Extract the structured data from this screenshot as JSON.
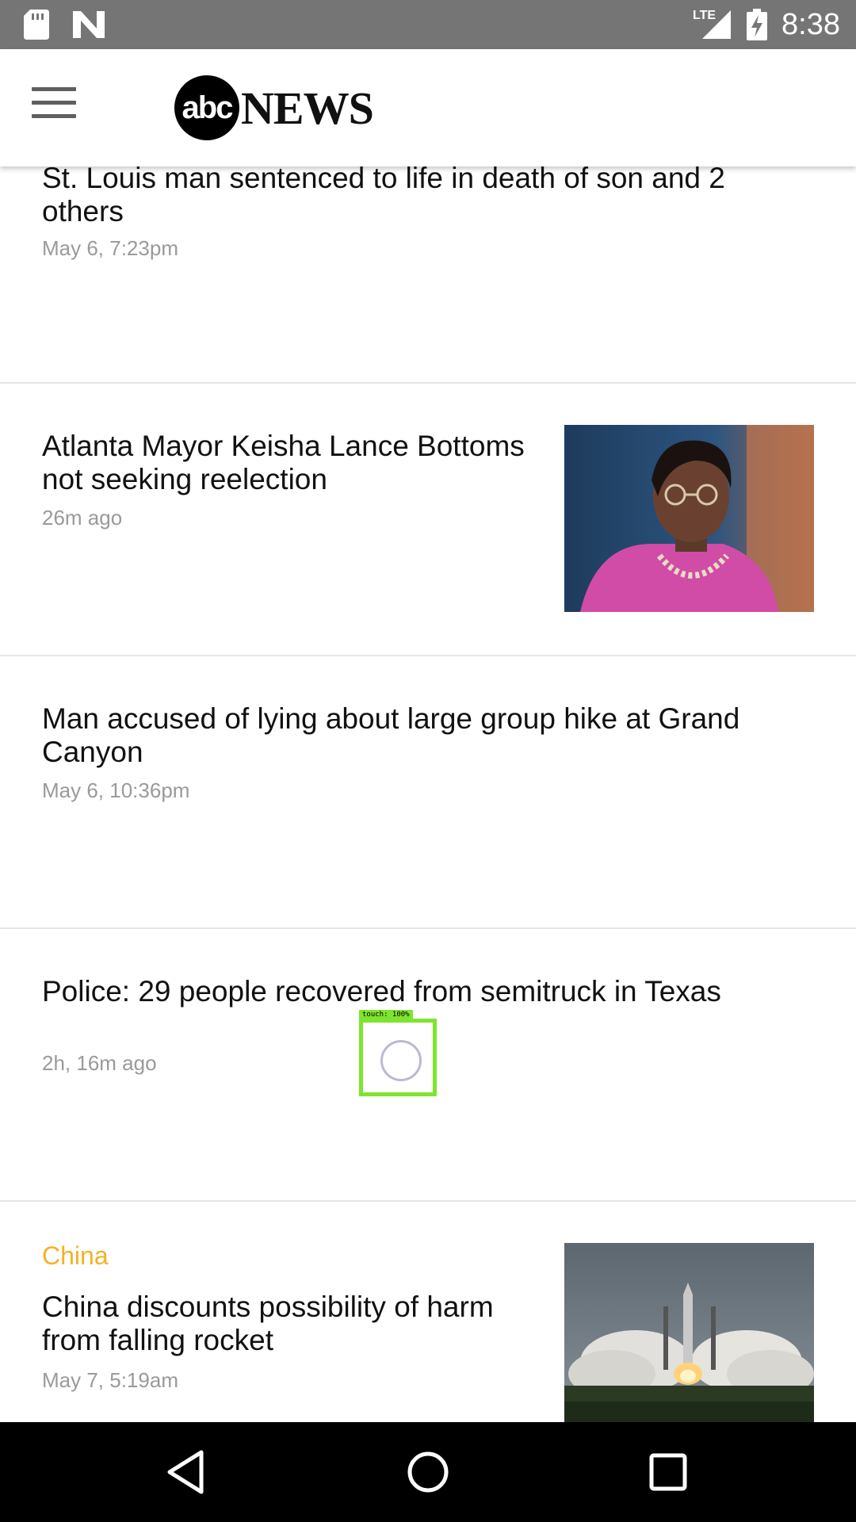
{
  "status_bar": {
    "time": "8:38",
    "network": "LTE",
    "icons": [
      "sd-card-icon",
      "n-notification-icon",
      "lte-signal-icon",
      "battery-charging-icon"
    ]
  },
  "header": {
    "logo_abc": "abc",
    "logo_news": "NEWS",
    "menu_icon": "hamburger-menu-icon"
  },
  "articles": [
    {
      "title": "St. Louis man sentenced to life in death of son and 2 others",
      "time": "May 6, 7:23pm"
    },
    {
      "title": "Atlanta Mayor Keisha Lance Bottoms not seeking reelection",
      "time": "26m ago"
    },
    {
      "title": "Man accused of lying about large group hike at Grand Canyon",
      "time": "May 6, 10:36pm"
    },
    {
      "title": "Police: 29 people recovered from semitruck in Texas",
      "time": "2h, 16m ago"
    },
    {
      "category": "China",
      "title": "China discounts possibility of harm from falling rocket",
      "time": "May 7, 5:19am"
    }
  ],
  "touch_indicator": {
    "label": "touch: 100%"
  },
  "nav_bar": {
    "icons": [
      "back-icon",
      "home-icon",
      "recents-icon"
    ]
  },
  "colors": {
    "accent_category": "#f4b223",
    "status_bar": "#757575",
    "touch": "#7ee52e"
  }
}
